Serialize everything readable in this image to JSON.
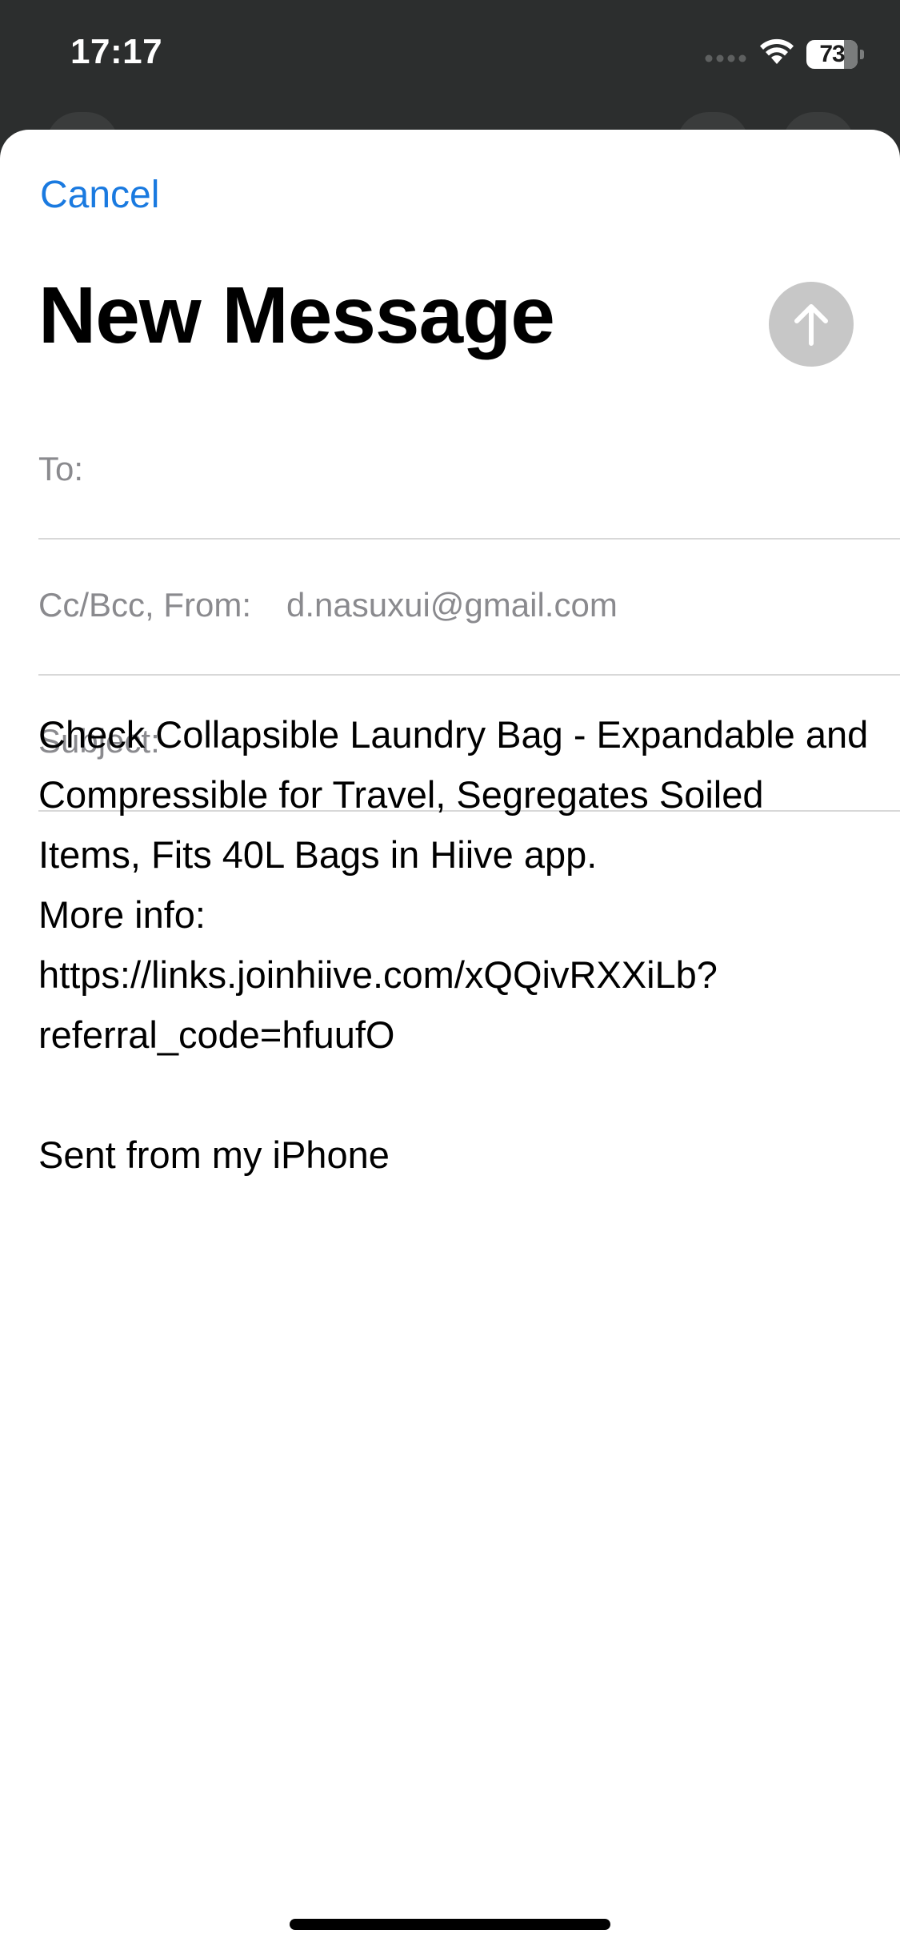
{
  "status_bar": {
    "time": "17:17",
    "battery_percent": 73,
    "battery_label": "73",
    "icons": [
      "signal-icon",
      "wifi-icon",
      "battery-icon"
    ]
  },
  "compose": {
    "cancel_label": "Cancel",
    "title": "New Message",
    "send_icon": "arrow-up-icon",
    "fields": {
      "to_label": "To:",
      "to_value": "",
      "ccbcc_label": "Cc/Bcc, From:",
      "from_value": "d.nasuxui@gmail.com",
      "subject_label": "Subject:",
      "subject_value": ""
    },
    "body": "Check Collapsible Laundry Bag - Expandable and Compressible for Travel, Segregates Soiled Items, Fits 40L Bags in Hiive app.\nMore info: https://links.joinhiive.com/xQQivRXXiLb?referral_code=hfuufO\n\nSent from my iPhone"
  },
  "colors": {
    "accent": "#1a7ae0",
    "send_disabled": "#c7c7c7",
    "label_gray": "#8a8a8e",
    "backdrop": "#2c2e2e"
  }
}
